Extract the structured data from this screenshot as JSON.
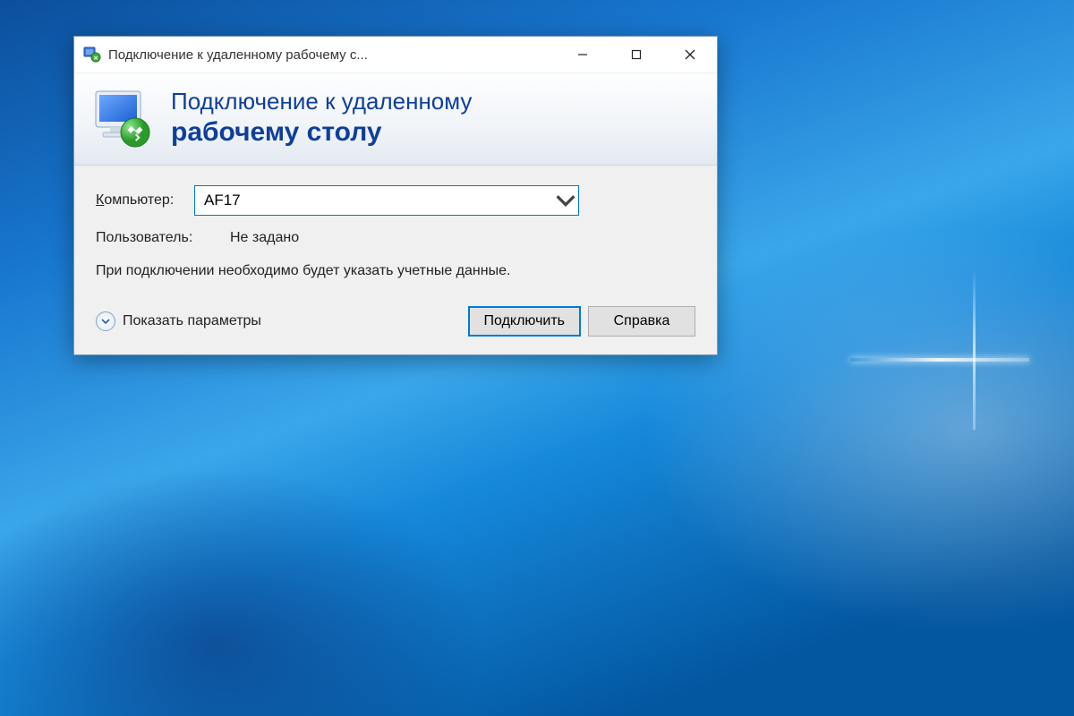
{
  "window": {
    "title": "Подключение к удаленному рабочему с..."
  },
  "header": {
    "line1": "Подключение к удаленному",
    "line2": "рабочему столу"
  },
  "form": {
    "computer_label": "Компьютер:",
    "computer_value": "AF17",
    "user_label": "Пользователь:",
    "user_value": "Не задано",
    "hint": "При подключении необходимо будет указать учетные данные."
  },
  "footer": {
    "show_options": "Показать параметры",
    "connect": "Подключить",
    "help": "Справка"
  }
}
